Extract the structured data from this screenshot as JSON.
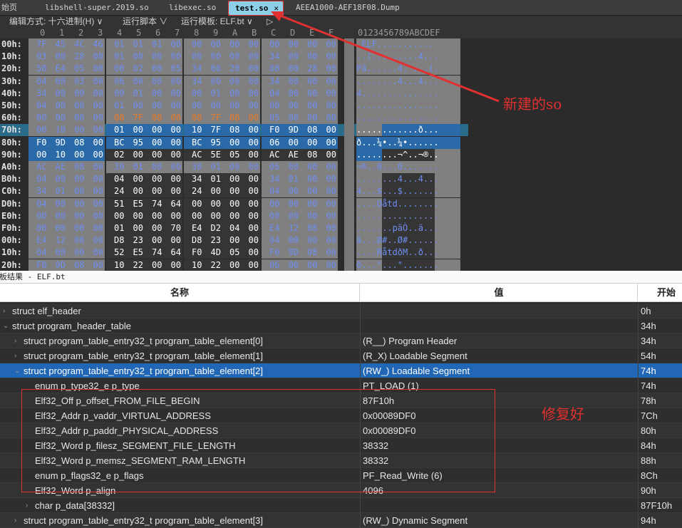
{
  "tabs": {
    "home": "始页",
    "items": [
      "libshell-super.2019.so",
      "libexec.so",
      "test.so",
      "AEEA1000-AEF18F08.Dump"
    ],
    "close_glyph": "✕"
  },
  "toolbar": {
    "edit_mode": "编辑方式: 十六进制(H) ∨",
    "run_script": "运行脚本 ∨",
    "run_template": "运行模板: ELF.bt ∨",
    "play_glyph": "▷"
  },
  "hex_header": {
    "columns": [
      "0",
      "1",
      "2",
      "3",
      "4",
      "5",
      "6",
      "7",
      "8",
      "9",
      "A",
      "B",
      "C",
      "D",
      "E",
      "F"
    ],
    "ascii_header": "0123456789ABCDEF"
  },
  "hex_rows": [
    {
      "addr": "00h:",
      "bytes": [
        "7F",
        "45",
        "4C",
        "46",
        "01",
        "01",
        "01",
        "00",
        "00",
        "00",
        "00",
        "00",
        "00",
        "00",
        "00",
        "00"
      ],
      "ascii": ".ELF..........."
    },
    {
      "addr": "10h:",
      "bytes": [
        "03",
        "00",
        "28",
        "00",
        "01",
        "00",
        "00",
        "00",
        "00",
        "00",
        "00",
        "00",
        "34",
        "00",
        "00",
        "00"
      ],
      "ascii": "..(.........4..."
    },
    {
      "addr": "20h:",
      "bytes": [
        "50",
        "E4",
        "05",
        "00",
        "00",
        "02",
        "00",
        "05",
        "34",
        "00",
        "20",
        "00",
        "08",
        "00",
        "28",
        "00"
      ],
      "ascii": "Pä......4. ...(."
    },
    {
      "addr": "30h:",
      "bytes": [
        "04",
        "00",
        "03",
        "00",
        "06",
        "00",
        "00",
        "00",
        "34",
        "00",
        "00",
        "00",
        "34",
        "00",
        "00",
        "00"
      ],
      "ascii": "........4...4..."
    },
    {
      "addr": "40h:",
      "bytes": [
        "34",
        "00",
        "00",
        "00",
        "00",
        "01",
        "00",
        "00",
        "00",
        "01",
        "00",
        "00",
        "04",
        "00",
        "00",
        "00"
      ],
      "ascii": "4..............."
    },
    {
      "addr": "50h:",
      "bytes": [
        "04",
        "00",
        "00",
        "00",
        "01",
        "00",
        "00",
        "00",
        "00",
        "00",
        "00",
        "00",
        "00",
        "00",
        "00",
        "00"
      ],
      "ascii": "................"
    },
    {
      "addr": "60h:",
      "bytes": [
        "00",
        "00",
        "00",
        "00",
        "08",
        "7F",
        "08",
        "00",
        "08",
        "7F",
        "08",
        "00",
        "05",
        "00",
        "00",
        "00"
      ],
      "ascii": "................"
    },
    {
      "addr": "70h:",
      "bytes": [
        "00",
        "10",
        "00",
        "00",
        "01",
        "00",
        "00",
        "00",
        "10",
        "7F",
        "08",
        "00",
        "F0",
        "9D",
        "08",
        "00"
      ],
      "ascii": "............ð..."
    },
    {
      "addr": "80h:",
      "bytes": [
        "F0",
        "9D",
        "08",
        "00",
        "BC",
        "95",
        "00",
        "00",
        "BC",
        "95",
        "00",
        "00",
        "06",
        "00",
        "00",
        "00"
      ],
      "ascii": "ð...¼•..¼•......"
    },
    {
      "addr": "90h:",
      "bytes": [
        "00",
        "10",
        "00",
        "00",
        "02",
        "00",
        "00",
        "00",
        "AC",
        "5E",
        "05",
        "00",
        "AC",
        "AE",
        "08",
        "00"
      ],
      "ascii": "........¬^..¬®.."
    },
    {
      "addr": "A0h:",
      "bytes": [
        "AC",
        "AE",
        "08",
        "00",
        "30",
        "01",
        "00",
        "00",
        "30",
        "01",
        "00",
        "00",
        "06",
        "00",
        "00",
        "00"
      ],
      "ascii": "¬®..0...0......."
    },
    {
      "addr": "B0h:",
      "bytes": [
        "04",
        "00",
        "00",
        "00",
        "04",
        "00",
        "00",
        "00",
        "34",
        "01",
        "00",
        "00",
        "34",
        "01",
        "00",
        "00"
      ],
      "ascii": "........4...4..."
    },
    {
      "addr": "C0h:",
      "bytes": [
        "34",
        "01",
        "00",
        "00",
        "24",
        "00",
        "00",
        "00",
        "24",
        "00",
        "00",
        "00",
        "04",
        "00",
        "00",
        "00"
      ],
      "ascii": "4...$...$......."
    },
    {
      "addr": "D0h:",
      "bytes": [
        "04",
        "00",
        "00",
        "00",
        "51",
        "E5",
        "74",
        "64",
        "00",
        "00",
        "00",
        "00",
        "00",
        "00",
        "00",
        "00"
      ],
      "ascii": "....Qåtd........"
    },
    {
      "addr": "E0h:",
      "bytes": [
        "00",
        "00",
        "00",
        "00",
        "00",
        "00",
        "00",
        "00",
        "00",
        "00",
        "00",
        "00",
        "00",
        "00",
        "00",
        "00"
      ],
      "ascii": "................"
    },
    {
      "addr": "F0h:",
      "bytes": [
        "00",
        "00",
        "00",
        "00",
        "01",
        "00",
        "00",
        "70",
        "E4",
        "D2",
        "04",
        "00",
        "E4",
        "12",
        "08",
        "00"
      ],
      "ascii": ".......päÒ..ä..."
    },
    {
      "addr": "00h:",
      "bytes": [
        "E4",
        "12",
        "08",
        "00",
        "D8",
        "23",
        "00",
        "00",
        "D8",
        "23",
        "00",
        "00",
        "04",
        "00",
        "00",
        "00"
      ],
      "ascii": "ä...Ø#..Ø#......"
    },
    {
      "addr": "10h:",
      "bytes": [
        "04",
        "00",
        "00",
        "00",
        "52",
        "E5",
        "74",
        "64",
        "F0",
        "4D",
        "05",
        "00",
        "F0",
        "9D",
        "08",
        "00"
      ],
      "ascii": "....RåtdðM..ð..."
    },
    {
      "addr": "20h:",
      "bytes": [
        "F0",
        "9D",
        "08",
        "00",
        "10",
        "22",
        "00",
        "00",
        "10",
        "22",
        "00",
        "00",
        "06",
        "00",
        "00",
        "00"
      ],
      "ascii": "ð...\"...\"......."
    }
  ],
  "callout": {
    "new_so": "新建的so",
    "fixed": "修复好"
  },
  "results": {
    "bar_title": "模板结果 - ELF.bt",
    "col_name": "名称",
    "col_value": "值",
    "col_start": "开始",
    "rows": [
      {
        "name": "struct elf_header",
        "value": "",
        "start": "0h",
        "indent": 0,
        "expander": "›"
      },
      {
        "name": "struct program_header_table",
        "value": "",
        "start": "34h",
        "indent": 0,
        "expander": "⌄"
      },
      {
        "name": "struct program_table_entry32_t program_table_element[0]",
        "value": "(R__) Program Header",
        "start": "34h",
        "indent": 1,
        "expander": "›"
      },
      {
        "name": "struct program_table_entry32_t program_table_element[1]",
        "value": "(R_X) Loadable Segment",
        "start": "54h",
        "indent": 1,
        "expander": "›"
      },
      {
        "name": "struct program_table_entry32_t program_table_element[2]",
        "value": "(RW_) Loadable Segment",
        "start": "74h",
        "indent": 1,
        "expander": "⌄"
      },
      {
        "name": "enum p_type32_e p_type",
        "value": "PT_LOAD (1)",
        "start": "74h",
        "indent": 2,
        "expander": ""
      },
      {
        "name": "Elf32_Off p_offset_FROM_FILE_BEGIN",
        "value": "87F10h",
        "start": "78h",
        "indent": 2,
        "expander": ""
      },
      {
        "name": "Elf32_Addr p_vaddr_VIRTUAL_ADDRESS",
        "value": "0x00089DF0",
        "start": "7Ch",
        "indent": 2,
        "expander": ""
      },
      {
        "name": "Elf32_Addr p_paddr_PHYSICAL_ADDRESS",
        "value": "0x00089DF0",
        "start": "80h",
        "indent": 2,
        "expander": ""
      },
      {
        "name": "Elf32_Word p_filesz_SEGMENT_FILE_LENGTH",
        "value": "38332",
        "start": "84h",
        "indent": 2,
        "expander": ""
      },
      {
        "name": "Elf32_Word p_memsz_SEGMENT_RAM_LENGTH",
        "value": "38332",
        "start": "88h",
        "indent": 2,
        "expander": ""
      },
      {
        "name": "enum p_flags32_e p_flags",
        "value": "PF_Read_Write (6)",
        "start": "8Ch",
        "indent": 2,
        "expander": ""
      },
      {
        "name": "Elf32_Word p_align",
        "value": "4096",
        "start": "90h",
        "indent": 2,
        "expander": ""
      },
      {
        "name": "char p_data[38332]",
        "value": "",
        "start": "87F10h",
        "indent": 2,
        "expander": "›"
      },
      {
        "name": "struct program_table_entry32_t program_table_element[3]",
        "value": "(RW_) Dynamic Segment",
        "start": "94h",
        "indent": 1,
        "expander": "›"
      }
    ]
  },
  "colors": {
    "selection": "#2167b5",
    "callout_red": "#e03030",
    "active_tab": "#8ccfe8"
  }
}
